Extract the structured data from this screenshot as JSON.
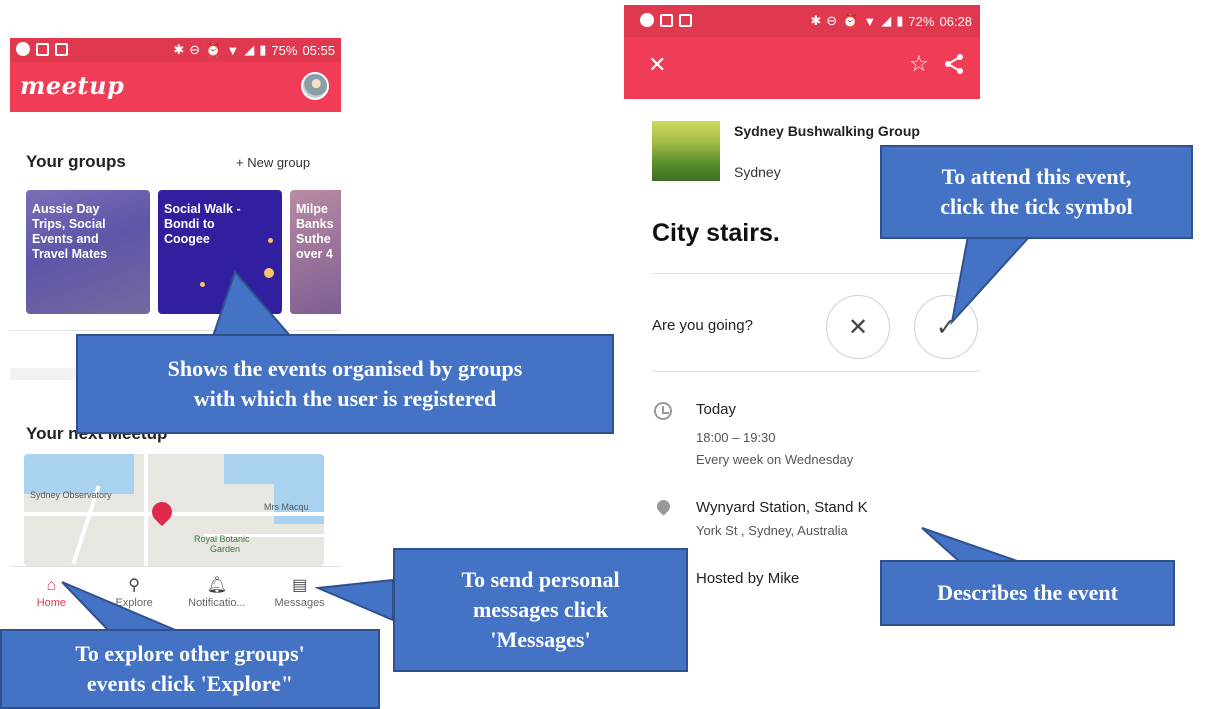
{
  "left_phone": {
    "status": {
      "battery": "75%",
      "time": "05:55"
    },
    "app_logo": "meetup",
    "your_groups": {
      "title": "Your groups",
      "new_group": "+ New group",
      "cards": [
        {
          "lines": [
            "Aussie Day",
            "Trips, Social",
            "Events and",
            "Travel Mates"
          ]
        },
        {
          "lines": [
            "Social Walk -",
            "Bondi to",
            "Coogee"
          ]
        },
        {
          "lines": [
            "Milpe",
            "Banks",
            "Suthe",
            "over 4"
          ]
        }
      ]
    },
    "next_meetup": {
      "title": "Your next Meetup",
      "map_labels": [
        "Sydney Observatory",
        "Mrs Macqu",
        "Royal Botanic",
        "Garden"
      ]
    },
    "bottom_nav": [
      {
        "label": "Home",
        "icon": "home-icon"
      },
      {
        "label": "Explore",
        "icon": "search-icon"
      },
      {
        "label": "Notificatio...",
        "icon": "bell-icon"
      },
      {
        "label": "Messages",
        "icon": "message-icon"
      }
    ]
  },
  "right_phone": {
    "status": {
      "battery": "72%",
      "time": "06:28"
    },
    "group_name": "Sydney Bushwalking Group",
    "group_city": "Sydney",
    "event_title": "City stairs.",
    "going_question": "Are you going?",
    "date": "Today",
    "time": "18:00 – 19:30",
    "repeat": "Every week on Wednesday",
    "venue": "Wynyard Station, Stand K",
    "address": "York St , Sydney, Australia",
    "host": "Hosted by Mike"
  },
  "callouts": {
    "groups": [
      "Shows the events organised by groups",
      "with which the user is registered"
    ],
    "explore": [
      "To explore other groups'",
      "events click 'Explore\""
    ],
    "messages": [
      "To send personal",
      "messages click",
      "'Messages'"
    ],
    "attend": [
      "To attend this event,",
      "click the tick symbol"
    ],
    "describe": "Describes the event"
  },
  "colors": {
    "brand": "#f03c56",
    "status_bar": "#e0394f",
    "callout": "#4472c4"
  }
}
